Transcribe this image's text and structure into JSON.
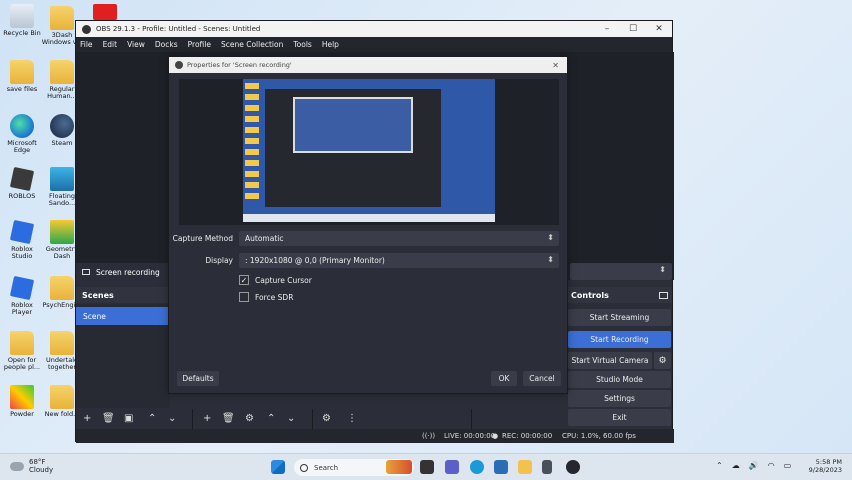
{
  "desktop": {
    "icons": [
      {
        "label": "Recycle Bin",
        "icon": "recycle-bin-icon"
      },
      {
        "label": "3Dash Windows v...",
        "icon": "folder-icon"
      },
      {
        "label": "save files",
        "icon": "folder-icon"
      },
      {
        "label": "Regular Human...",
        "icon": "folder-icon"
      },
      {
        "label": "Microsoft Edge",
        "icon": "edge-icon"
      },
      {
        "label": "Steam",
        "icon": "steam-icon"
      },
      {
        "label": "ROBLOS",
        "icon": "roblox-icon"
      },
      {
        "label": "Floating Sando...",
        "icon": "app-icon"
      },
      {
        "label": "Roblox Studio",
        "icon": "roblox-studio-icon"
      },
      {
        "label": "Geometry Dash",
        "icon": "geometry-dash-icon"
      },
      {
        "label": "Roblox Player",
        "icon": "roblox-player-icon"
      },
      {
        "label": "PsychEngi...",
        "icon": "folder-icon"
      },
      {
        "label": "Open for people pl...",
        "icon": "folder-icon"
      },
      {
        "label": "Undertale together",
        "icon": "folder-icon"
      },
      {
        "label": "Powder",
        "icon": "powder-icon"
      },
      {
        "label": "New fold...",
        "icon": "folder-icon"
      }
    ]
  },
  "obs": {
    "title": "OBS 29.1.3 - Profile: Untitled - Scenes: Untitled",
    "menu": [
      "File",
      "Edit",
      "View",
      "Docks",
      "Profile",
      "Scene Collection",
      "Tools",
      "Help"
    ],
    "source_name": "Screen recording",
    "scenes_title": "Scenes",
    "scene_item": "Scene",
    "controls_title": "Controls",
    "controls": {
      "start_streaming": "Start Streaming",
      "start_recording": "Start Recording",
      "start_virtual_camera": "Start Virtual Camera",
      "studio_mode": "Studio Mode",
      "settings": "Settings",
      "exit": "Exit"
    },
    "status": {
      "live": "LIVE: 00:00:00",
      "rec": "REC: 00:00:00",
      "cpu": "CPU: 1.0%, 60.00 fps"
    }
  },
  "dialog": {
    "title": "Properties for 'Screen recording'",
    "capture_method_label": "Capture Method",
    "capture_method_value": "Automatic",
    "display_label": "Display",
    "display_value": ": 1920x1080 @ 0,0 (Primary Monitor)",
    "capture_cursor_label": "Capture Cursor",
    "capture_cursor_checked": true,
    "force_sdr_label": "Force SDR",
    "force_sdr_checked": false,
    "defaults": "Defaults",
    "ok": "OK",
    "cancel": "Cancel"
  },
  "taskbar": {
    "temperature": "68°F",
    "weather": "Cloudy",
    "search_placeholder": "Search",
    "time": "5:58 PM",
    "date": "9/28/2023"
  }
}
